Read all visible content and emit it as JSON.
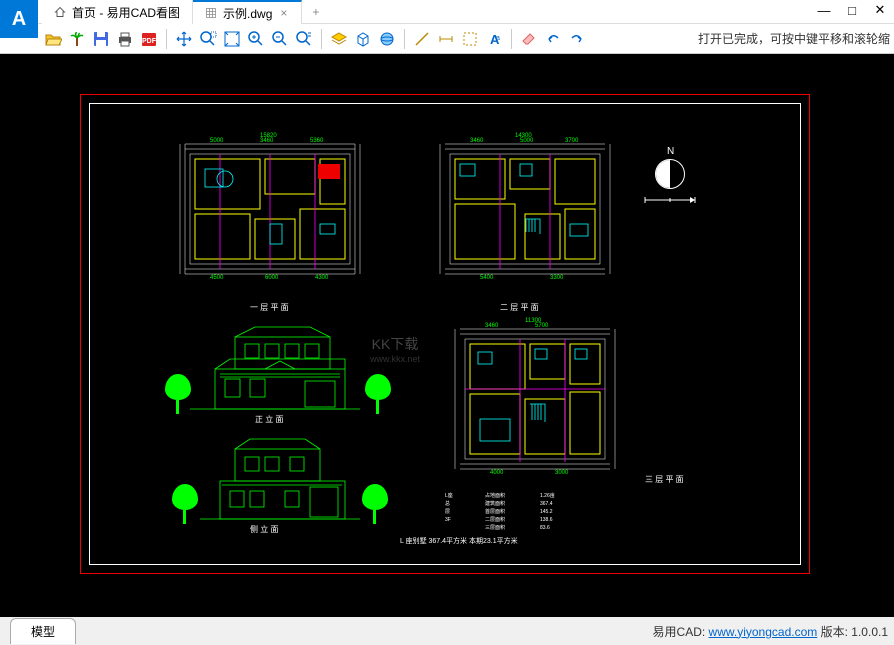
{
  "app": {
    "icon_letter": "A"
  },
  "tabs": {
    "home": "首页 - 易用CAD看图",
    "file": "示例.dwg"
  },
  "toolbar": {
    "message": "打开已完成，可按中键平移和滚轮缩"
  },
  "canvas": {
    "watermark": "KK下载",
    "watermark_url": "www.kkx.net",
    "compass_label": "N",
    "labels": {
      "plan1": "一 层 平 面",
      "plan2": "二 层 平 面",
      "plan3": "三 层 平 面",
      "elev1": "正 立 面",
      "elev2": "侧 立 面"
    },
    "info_block": {
      "area_line": "L 座别墅     367.4平方米     本期23.1平方米"
    },
    "dims": [
      "5000",
      "3460",
      "5360",
      "15820",
      "3460",
      "5000",
      "3300",
      "3700",
      "4500",
      "4300",
      "5400",
      "14300",
      "11300",
      "3000",
      "4000"
    ]
  },
  "status": {
    "tab": "模型",
    "brand": "易用CAD:",
    "url": "www.yiyongcad.com",
    "version_label": "版本:",
    "version": "1.0.0.1"
  }
}
